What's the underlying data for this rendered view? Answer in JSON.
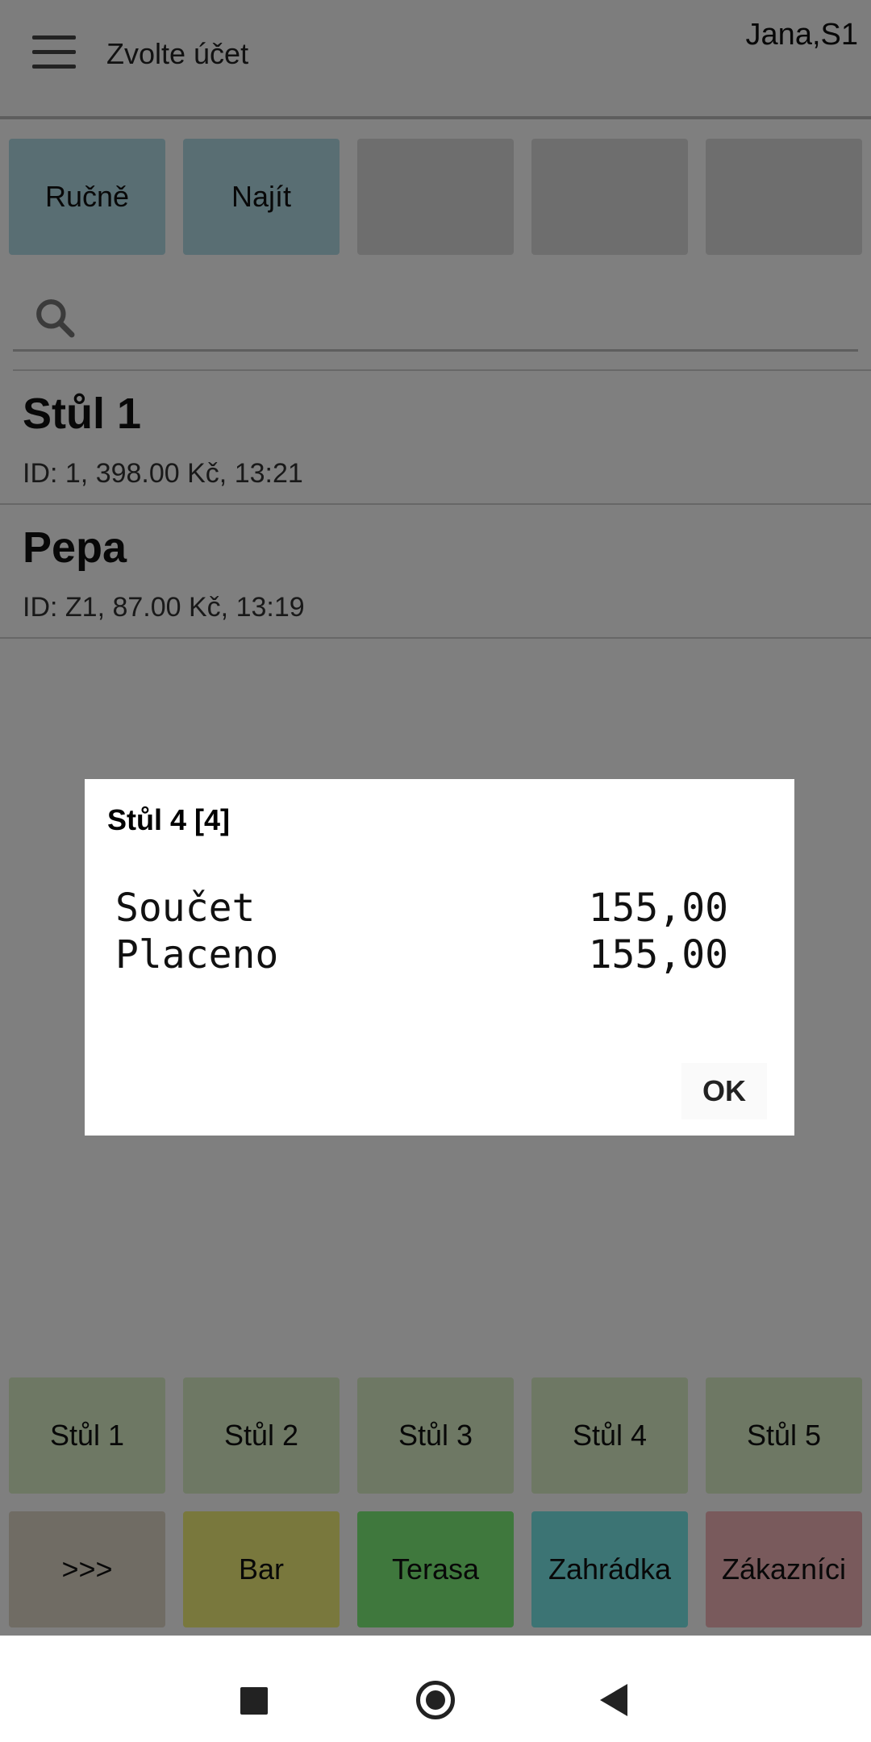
{
  "header": {
    "title": "Zvolte účet",
    "user": "Jana,S1"
  },
  "top_buttons": [
    {
      "label": "Ručně"
    },
    {
      "label": "Najít"
    },
    {
      "label": ""
    },
    {
      "label": ""
    },
    {
      "label": ""
    }
  ],
  "search": {
    "placeholder": ""
  },
  "accounts": [
    {
      "title": "Stůl 1",
      "detail": "ID: 1, 398.00 Kč, 13:21"
    },
    {
      "title": "Pepa",
      "detail": "ID: Z1, 87.00 Kč, 13:19"
    }
  ],
  "tables_row": [
    {
      "label": "Stůl 1"
    },
    {
      "label": "Stůl 2"
    },
    {
      "label": "Stůl 3"
    },
    {
      "label": "Stůl 4"
    },
    {
      "label": "Stůl 5"
    }
  ],
  "areas_row": [
    {
      "label": ">>>",
      "color": "#e0d8c8"
    },
    {
      "label": "Bar",
      "color": "#f2f07a"
    },
    {
      "label": "Terasa",
      "color": "#7ef07a"
    },
    {
      "label": "Zahrádka",
      "color": "#78e8e8"
    },
    {
      "label": "Zákazníci",
      "color": "#f2b4b8"
    }
  ],
  "dialog": {
    "title": "Stůl 4 [4]",
    "rows": [
      {
        "label": "Součet",
        "value": "155,00"
      },
      {
        "label": "Placeno",
        "value": "155,00"
      }
    ],
    "ok_label": "OK"
  },
  "colors": {
    "accent_blue": "#b3dde6",
    "table_green": "#dcf0c8",
    "overlay": "rgba(0,0,0,0.5)"
  }
}
